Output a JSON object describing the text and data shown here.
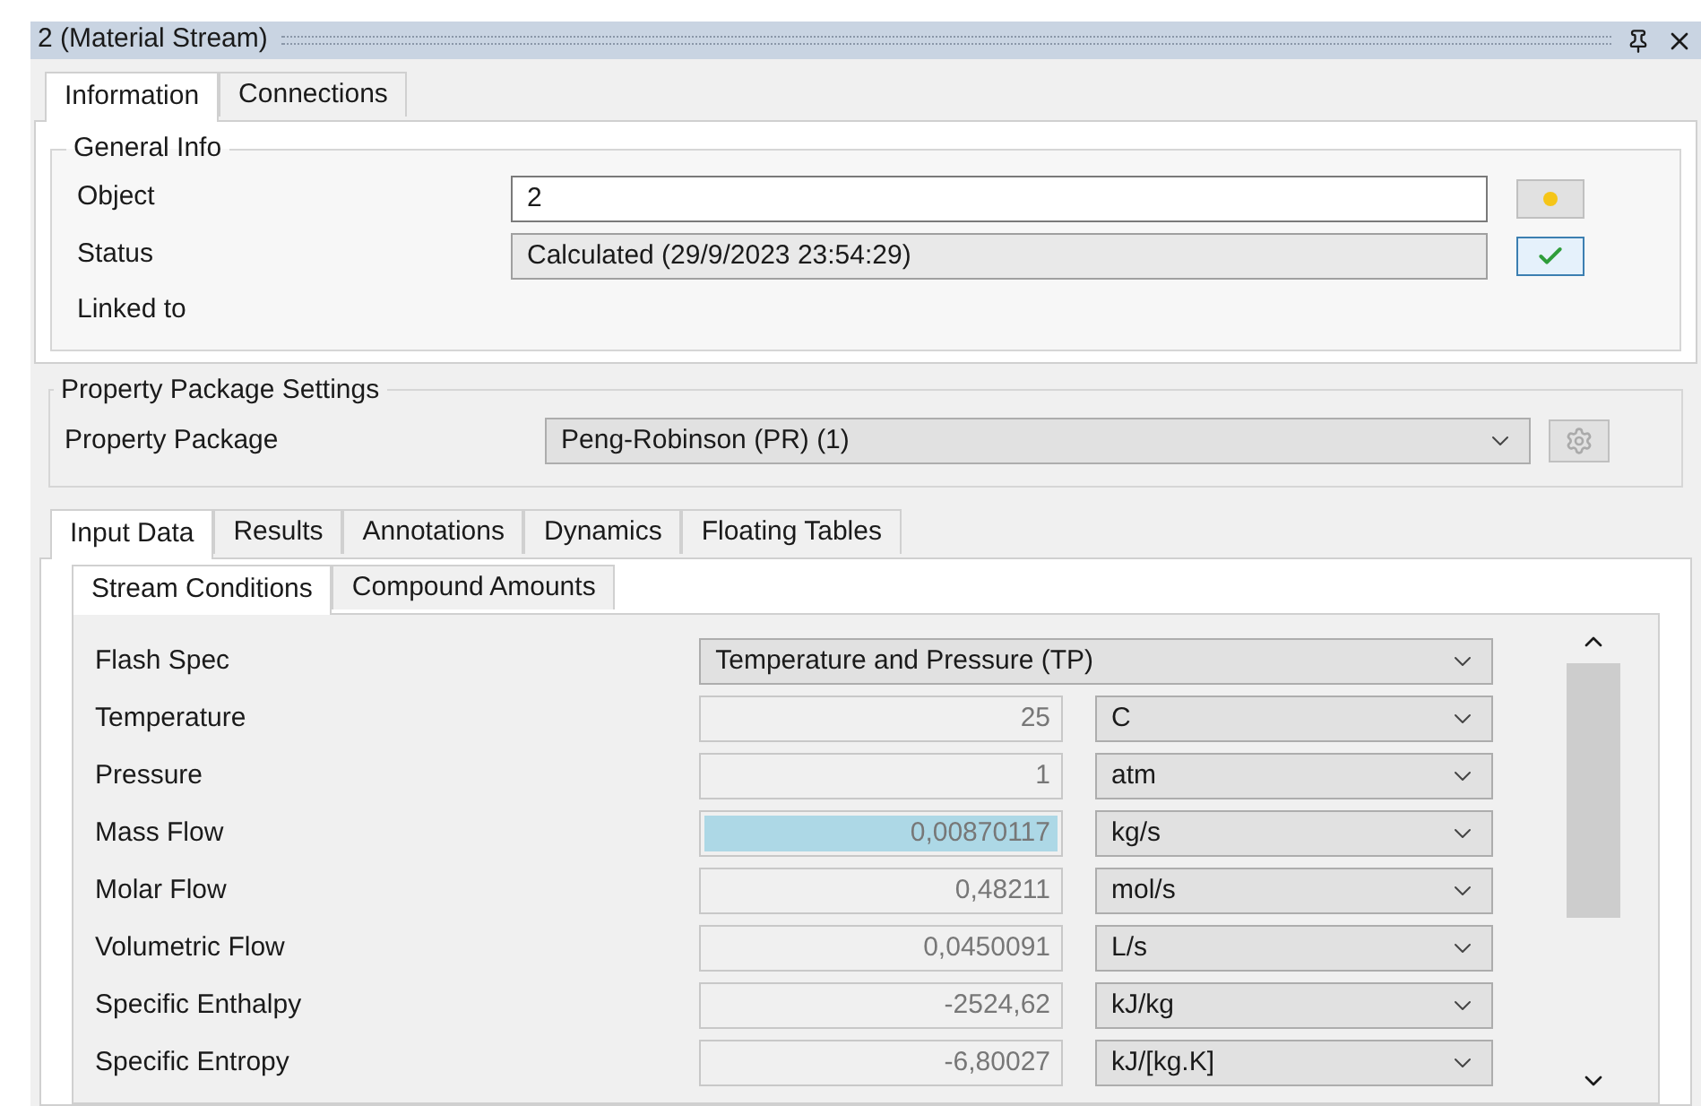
{
  "window": {
    "title": "2 (Material Stream)"
  },
  "top_tabs": [
    {
      "label": "Information",
      "selected": true
    },
    {
      "label": "Connections",
      "selected": false
    }
  ],
  "general_info": {
    "title": "General Info",
    "fields": [
      {
        "label": "Object",
        "value": "2",
        "readonly": false
      },
      {
        "label": "Status",
        "value": "Calculated (29/9/2023 23:54:29)",
        "readonly": true
      }
    ],
    "linked_to": "Linked to"
  },
  "property_package": {
    "title": "Property Package Settings",
    "label": "Property Package",
    "value": "Peng-Robinson (PR) (1)"
  },
  "data_tabs": [
    {
      "label": "Input Data",
      "selected": true
    },
    {
      "label": "Results",
      "selected": false
    },
    {
      "label": "Annotations",
      "selected": false
    },
    {
      "label": "Dynamics",
      "selected": false
    },
    {
      "label": "Floating Tables",
      "selected": false
    }
  ],
  "sub_tabs": [
    {
      "label": "Stream Conditions",
      "selected": true
    },
    {
      "label": "Compound Amounts",
      "selected": false
    }
  ],
  "flash_spec": {
    "label": "Flash Spec",
    "value": "Temperature and Pressure (TP)"
  },
  "conditions": [
    {
      "label": "Temperature",
      "value": "25",
      "unit": "C",
      "selected": false
    },
    {
      "label": "Pressure",
      "value": "1",
      "unit": "atm",
      "selected": false
    },
    {
      "label": "Mass Flow",
      "value": "0,00870117",
      "unit": "kg/s",
      "selected": true
    },
    {
      "label": "Molar Flow",
      "value": "0,48211",
      "unit": "mol/s",
      "selected": false
    },
    {
      "label": "Volumetric Flow",
      "value": "0,0450091",
      "unit": "L/s",
      "selected": false
    },
    {
      "label": "Specific Enthalpy",
      "value": "-2524,62",
      "unit": "kJ/kg",
      "selected": false
    },
    {
      "label": "Specific Entropy",
      "value": "-6,80027",
      "unit": "kJ/[kg.K]",
      "selected": false
    }
  ]
}
